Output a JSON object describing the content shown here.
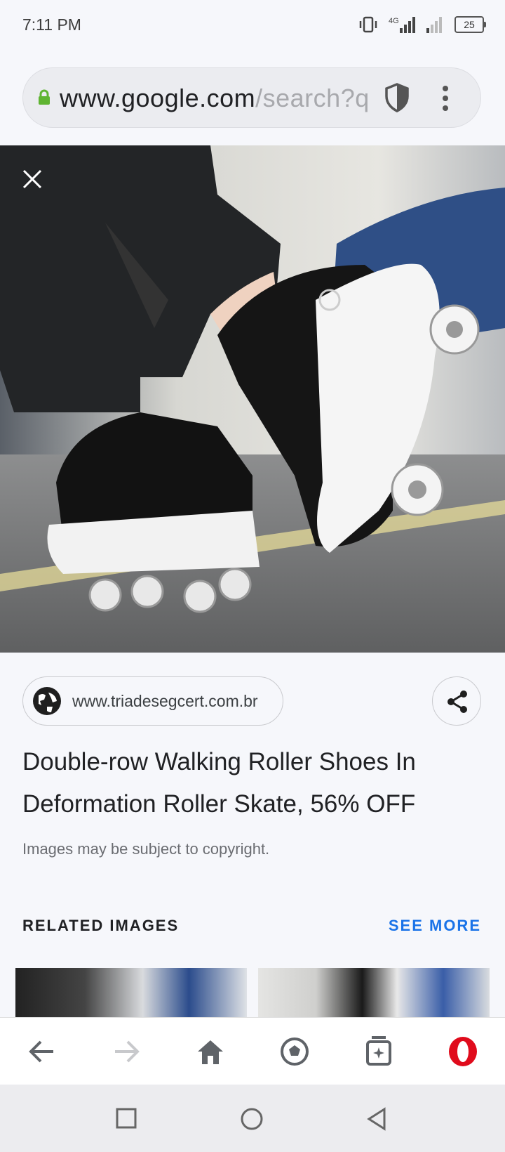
{
  "status_bar": {
    "time": "7:11 PM",
    "network": "4G",
    "battery": "25"
  },
  "browser": {
    "url_domain": "www.google.com",
    "url_path": "/search?q"
  },
  "result": {
    "source": "www.triadesegcert.com.br",
    "title": "Double-row Walking Roller Shoes In Deformation Roller Skate, 56% OFF",
    "copyright": "Images may be subject to copyright."
  },
  "related": {
    "label": "RELATED IMAGES",
    "see_more": "SEE MORE"
  },
  "colors": {
    "accent": "#1a73e8",
    "lock": "#5fb432",
    "opera": "#e00b1c"
  },
  "icons": {
    "close": "close-icon",
    "globe": "globe-icon",
    "share": "share-icon",
    "back": "back-arrow-icon",
    "forward": "forward-arrow-icon",
    "home": "home-icon",
    "discover": "soccer-ball-icon",
    "tabs": "tabs-icon",
    "opera": "opera-logo-icon"
  }
}
